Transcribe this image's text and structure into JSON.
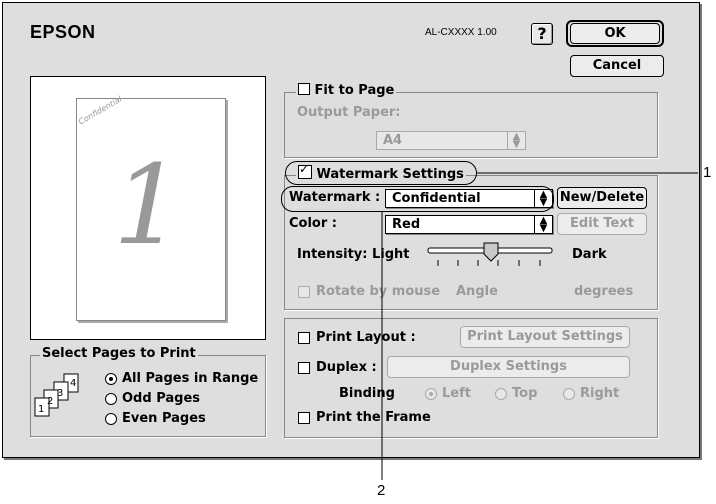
{
  "brand": "EPSON",
  "model": "AL-CXXXX 1.00",
  "help_label": "?",
  "buttons": {
    "ok": "OK",
    "cancel": "Cancel"
  },
  "preview": {
    "page_number": "1",
    "watermark_text": "Confidential"
  },
  "fit_to_page": {
    "label": "Fit to Page",
    "output_paper_label": "Output Paper:",
    "paper_value": "A4"
  },
  "watermark": {
    "settings_label": "Watermark Settings",
    "watermark_label": "Watermark :",
    "watermark_value": "Confidential",
    "new_delete": "New/Delete",
    "color_label": "Color :",
    "color_value": "Red",
    "edit_text": "Edit Text",
    "intensity_label": "Intensity: Light",
    "intensity_dark": "Dark",
    "intensity_level": 0.5,
    "rotate_label": "Rotate by mouse",
    "angle_label": "Angle",
    "degrees_label": "degrees"
  },
  "layout": {
    "print_layout_label": "Print Layout :",
    "print_layout_settings": "Print Layout Settings",
    "duplex_label": "Duplex :",
    "duplex_settings": "Duplex Settings",
    "binding_label": "Binding",
    "binding_options": [
      "Left",
      "Top",
      "Right"
    ],
    "binding_selected": "Left",
    "print_frame_label": "Print the Frame"
  },
  "select_pages": {
    "title": "Select Pages to Print",
    "options": [
      "All Pages in Range",
      "Odd Pages",
      "Even Pages"
    ],
    "selected": "All Pages in Range",
    "icon_numbers": [
      "1",
      "2",
      "3",
      "4"
    ]
  },
  "callouts": [
    "1",
    "2"
  ]
}
